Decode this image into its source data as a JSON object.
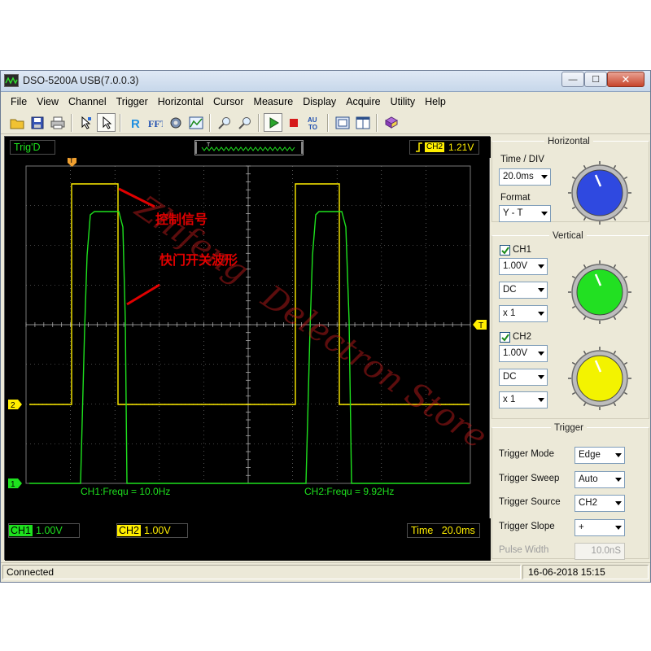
{
  "window": {
    "title": "DSO-5200A USB(7.0.0.3)",
    "min_glyph": "—",
    "max_glyph": "☐",
    "close_glyph": "✕"
  },
  "menu": [
    "File",
    "View",
    "Channel",
    "Trigger",
    "Horizontal",
    "Cursor",
    "Measure",
    "Display",
    "Acquire",
    "Utility",
    "Help"
  ],
  "toolbar": {
    "icons": [
      "open-folder-icon",
      "save-disk-icon",
      "print-icon",
      "select-arrow-icon",
      "pointer-icon",
      "reference-r-icon",
      "fft-icon",
      "channel-settings-icon",
      "chart-icon",
      "zoom-in-icon",
      "zoom-out-icon",
      "run-icon",
      "stop-icon",
      "auto-icon",
      "fit-screen-icon",
      "window-layout-icon",
      "book-icon"
    ]
  },
  "scope": {
    "trig_status": "Trig'D",
    "trigger_channel_tag": "CH2",
    "trigger_level": "1.21V",
    "trigger_marker": "T",
    "ch1_marker": "1",
    "ch2_marker": "2",
    "trigger_position_marker": "T",
    "ch1_freq": "CH1:Frequ = 10.0Hz",
    "ch2_freq": "CH2:Frequ = 9.92Hz",
    "watermark_1": "Zhifeng",
    "watermark_2": "Delectron Store",
    "annotation_control": "控制信号",
    "annotation_shutter": "快门开关波形",
    "ch1_tag_label": "CH1",
    "ch1_scale": "1.00V",
    "ch2_tag_label": "CH2",
    "ch2_scale": "1.00V",
    "time_label": "Time",
    "time_value": "20.0ms",
    "colors": {
      "ch1": "#1ee11e",
      "ch2": "#ffee00",
      "grid": "#8a8a8a",
      "annotation": "#e00000"
    }
  },
  "panel": {
    "horizontal": {
      "title": "Horizontal",
      "time_div_label": "Time / DIV",
      "time_div_value": "20.0ms",
      "format_label": "Format",
      "format_value": "Y - T",
      "knob_color": "#2f49e0"
    },
    "vertical": {
      "title": "Vertical",
      "ch1_label": "CH1",
      "ch1_checked": true,
      "ch1_volts": "1.00V",
      "ch1_coupling": "DC",
      "ch1_probe": "x 1",
      "ch1_knob_color": "#22e022",
      "ch2_label": "CH2",
      "ch2_checked": true,
      "ch2_volts": "1.00V",
      "ch2_coupling": "DC",
      "ch2_probe": "x 1",
      "ch2_knob_color": "#f3f300"
    },
    "trigger": {
      "title": "Trigger",
      "mode_label": "Trigger Mode",
      "mode_value": "Edge",
      "sweep_label": "Trigger Sweep",
      "sweep_value": "Auto",
      "source_label": "Trigger Source",
      "source_value": "CH2",
      "slope_label": "Trigger Slope",
      "slope_value": "+",
      "pulse_label": "Pulse Width",
      "pulse_value": "10.0nS"
    }
  },
  "statusbar": {
    "left": "Connected",
    "right": "16-06-2018  15:15"
  }
}
